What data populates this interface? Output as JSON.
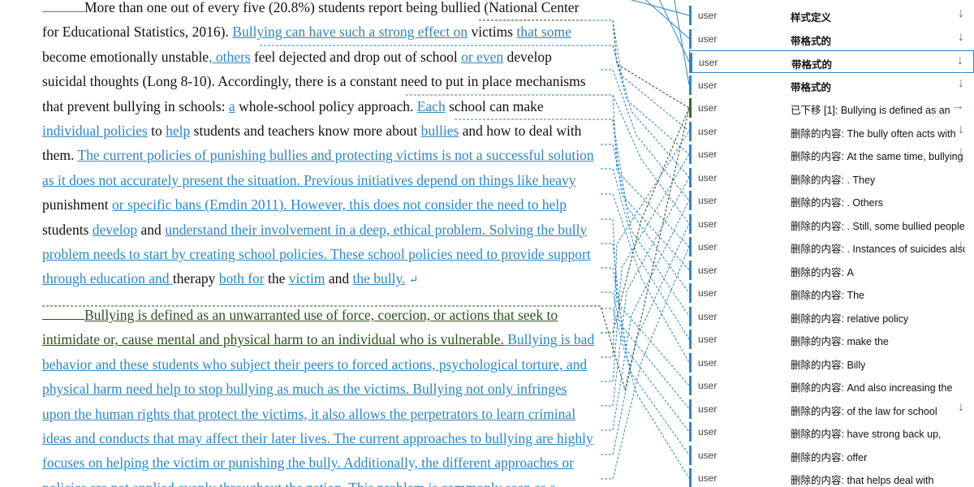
{
  "document": {
    "para1": [
      [
        {
          "t": "blank",
          "w": 52
        },
        {
          "t": "n",
          "s": "More than one out of every five (20.8%) students report being bullied (National Center"
        }
      ],
      [
        {
          "t": "n",
          "s": "for Educational Statistics, 2016). "
        },
        {
          "t": "i",
          "s": "Bullying can have such a strong effect on"
        },
        {
          "t": "n",
          "s": " victims "
        },
        {
          "t": "i",
          "s": "that some"
        }
      ],
      [
        {
          "t": "n",
          "s": "become emotionally unstable"
        },
        {
          "t": "i",
          "s": ", others"
        },
        {
          "t": "n",
          "s": " feel dejected and drop out of school "
        },
        {
          "t": "i",
          "s": "or even"
        },
        {
          "t": "n",
          "s": " develop"
        }
      ],
      [
        {
          "t": "n",
          "s": "suicidal thoughts (Long 8-10). Accordingly, there is a constant need to put in place mechanisms"
        }
      ],
      [
        {
          "t": "n",
          "s": "that prevent bullying in schools: "
        },
        {
          "t": "i",
          "s": "a"
        },
        {
          "t": "n",
          "s": " whole-school policy approach. "
        },
        {
          "t": "i",
          "s": "Each"
        },
        {
          "t": "n",
          "s": " school can make"
        }
      ],
      [
        {
          "t": "i",
          "s": "individual policies"
        },
        {
          "t": "n",
          "s": " to "
        },
        {
          "t": "i",
          "s": "help"
        },
        {
          "t": "n",
          "s": " students and teachers know more about "
        },
        {
          "t": "i",
          "s": "bullies"
        },
        {
          "t": "n",
          "s": " and how to deal with"
        }
      ],
      [
        {
          "t": "n",
          "s": "them. "
        },
        {
          "t": "i",
          "s": "The current policies of punishing bullies and protecting victims is not a successful solution"
        }
      ],
      [
        {
          "t": "i",
          "s": "as it does not accurately present the situation. Previous initiatives depend on things like heavy"
        }
      ],
      [
        {
          "t": "n",
          "s": "punishment "
        },
        {
          "t": "i",
          "s": "or specific bans (Emdin 2011). However, this does not consider the need to help"
        }
      ],
      [
        {
          "t": "n",
          "s": "students "
        },
        {
          "t": "i",
          "s": "develop"
        },
        {
          "t": "n",
          "s": " and "
        },
        {
          "t": "i",
          "s": "understand their involvement in a deep, ethical problem. Solving the bully"
        }
      ],
      [
        {
          "t": "i",
          "s": "problem needs to start by creating school policies. These school policies need to provide support"
        }
      ],
      [
        {
          "t": "i",
          "s": "through education and "
        },
        {
          "t": "n",
          "s": "therapy "
        },
        {
          "t": "i",
          "s": "both for"
        },
        {
          "t": "n",
          "s": " the "
        },
        {
          "t": "i",
          "s": "victim"
        },
        {
          "t": "n",
          "s": " and "
        },
        {
          "t": "i",
          "s": "the bully."
        },
        {
          "t": "p",
          "s": "↵"
        }
      ]
    ],
    "para2": [
      [
        {
          "t": "mblank",
          "w": 52
        },
        {
          "t": "m",
          "s": "Bullying is defined as an unwarranted use of force, coercion, or actions that seek to"
        }
      ],
      [
        {
          "t": "m",
          "s": "intimidate or, cause mental and physical harm to an individual who is vulnerable."
        },
        {
          "t": "i",
          "s": " Bullying is bad"
        }
      ],
      [
        {
          "t": "i",
          "s": "behavior and these students who subject their peers to forced actions, psychological torture, and"
        }
      ],
      [
        {
          "t": "i",
          "s": "physical harm need help to stop bullying as much as the victims. Bullying not only infringes"
        }
      ],
      [
        {
          "t": "i",
          "s": "upon the human rights that protect the victims, it also allows the perpetrators to learn criminal"
        }
      ],
      [
        {
          "t": "i",
          "s": "ideas and conducts that may affect their later lives. The current approaches to bullying are highly"
        }
      ],
      [
        {
          "t": "i",
          "s": "focuses on helping the victim or punishing the bully. Additionally, the different approaches or"
        }
      ],
      [
        {
          "t": "i",
          "s": "policies are not applied evenly throughout the nation. This problem is commonly seen as a"
        }
      ]
    ]
  },
  "balloons": [
    {
      "author": "user",
      "text": "样式定义",
      "bold": true,
      "arrow": "↓",
      "arrow_color": "gray"
    },
    {
      "author": "user",
      "text": "带格式的",
      "bold": true,
      "arrow": "↓",
      "arrow_color": "gray"
    },
    {
      "author": "user",
      "text": "带格式的",
      "bold": true,
      "arrow": "↓",
      "arrow_color": "gray",
      "selected": true
    },
    {
      "author": "user",
      "text": "带格式的",
      "bold": true,
      "arrow": "↓",
      "arrow_color": "gray"
    },
    {
      "author": "user",
      "text": "已下移 [1]: Bullying is defined as an",
      "bold": false,
      "arrow": "→",
      "arrow_color": "blue",
      "moved": true
    },
    {
      "author": "user",
      "text": "删除的内容: The bully often acts with",
      "bold": false,
      "arrow": "↓",
      "arrow_color": "gray"
    },
    {
      "author": "user",
      "text": "删除的内容: At the same time, bullying",
      "bold": false,
      "arrow": "↓",
      "arrow_color": "gray"
    },
    {
      "author": "user",
      "text": "删除的内容: . They",
      "bold": false,
      "arrow": "",
      "arrow_color": "gray"
    },
    {
      "author": "user",
      "text": "删除的内容: . Others",
      "bold": false,
      "arrow": "",
      "arrow_color": "gray"
    },
    {
      "author": "user",
      "text": "删除的内容: . Still, some bullied people",
      "bold": false,
      "arrow": "",
      "arrow_color": "gray"
    },
    {
      "author": "user",
      "text": "删除的内容: . Instances of suicides also",
      "bold": false,
      "arrow": "↓",
      "arrow_color": "gray"
    },
    {
      "author": "user",
      "text": "删除的内容: A",
      "bold": false,
      "arrow": "",
      "arrow_color": "gray"
    },
    {
      "author": "user",
      "text": "删除的内容: The",
      "bold": false,
      "arrow": "",
      "arrow_color": "gray"
    },
    {
      "author": "user",
      "text": "删除的内容: relative policy",
      "bold": false,
      "arrow": "",
      "arrow_color": "gray"
    },
    {
      "author": "user",
      "text": "删除的内容: make the",
      "bold": false,
      "arrow": "",
      "arrow_color": "gray"
    },
    {
      "author": "user",
      "text": "删除的内容: Billy",
      "bold": false,
      "arrow": "",
      "arrow_color": "gray"
    },
    {
      "author": "user",
      "text": "删除的内容: And also increasing the",
      "bold": false,
      "arrow": "",
      "arrow_color": "gray"
    },
    {
      "author": "user",
      "text": "删除的内容: of the law for school",
      "bold": false,
      "arrow": "↓",
      "arrow_color": "gray"
    },
    {
      "author": "user",
      "text": "删除的内容: have strong back up,",
      "bold": false,
      "arrow": "",
      "arrow_color": "gray"
    },
    {
      "author": "user",
      "text": "删除的内容: offer",
      "bold": false,
      "arrow": "",
      "arrow_color": "gray"
    },
    {
      "author": "user",
      "text": "删除的内容: that helps deal with",
      "bold": false,
      "arrow": "",
      "arrow_color": "gray"
    }
  ],
  "colors": {
    "insert": "#2e86c1",
    "moved": "#2d4f1e",
    "connector": "#2e86c1",
    "connector_moved": "#2d4f1e"
  }
}
